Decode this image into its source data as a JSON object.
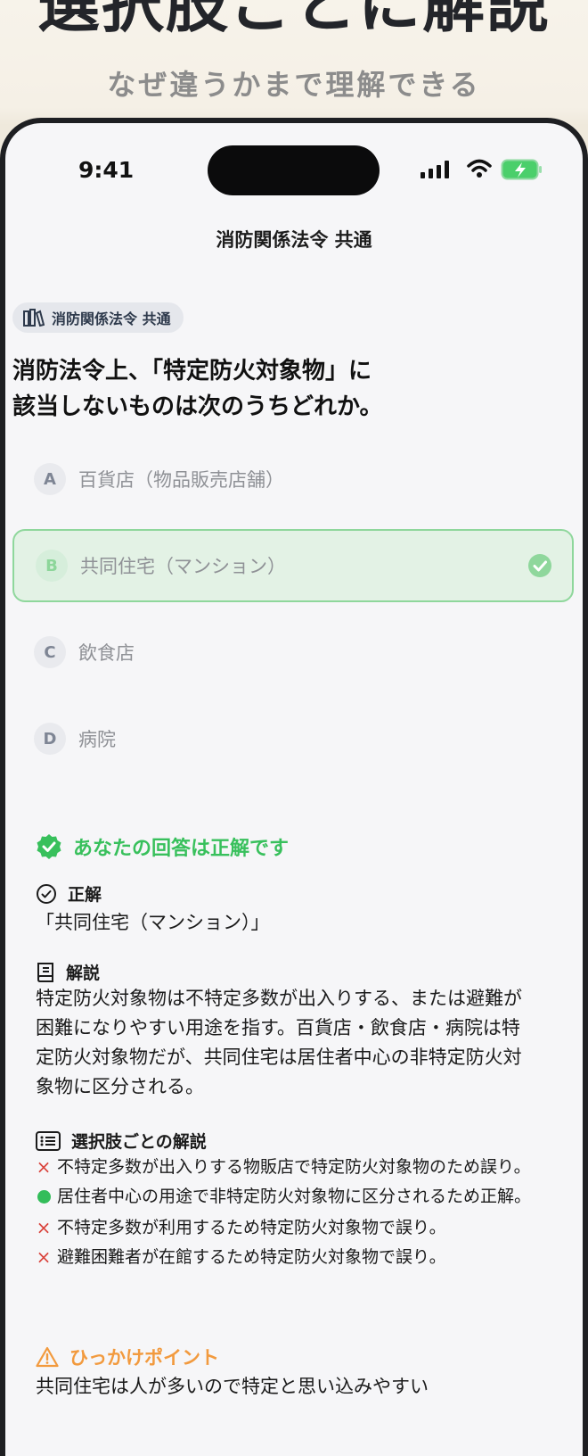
{
  "hero": {
    "title": "選択肢ごとに解説",
    "subtitle": "なぜ違うかまで理解できる"
  },
  "status_bar": {
    "time": "9:41",
    "icons": [
      "signal-icon",
      "wifi-icon",
      "battery-charging-icon"
    ]
  },
  "nav": {
    "title": "消防関係法令 共通"
  },
  "category_tag": {
    "icon": "book-shelf-icon",
    "label": "消防関係法令 共通"
  },
  "question": {
    "line1": "消防法令上、「特定防火対象物」に",
    "line2": "該当しないものは次のうちどれか。"
  },
  "options": [
    {
      "letter": "A",
      "text": "百貨店（物品販売店舗）",
      "state": "default"
    },
    {
      "letter": "B",
      "text": "共同住宅（マンション）",
      "state": "correct"
    },
    {
      "letter": "C",
      "text": "飲食店",
      "state": "default"
    },
    {
      "letter": "D",
      "text": "病院",
      "state": "default"
    }
  ],
  "result": {
    "icon": "check-badge-icon",
    "text": "あなたの回答は正解です"
  },
  "answer": {
    "heading": "正解",
    "value": "「共同住宅（マンション）」"
  },
  "explanation": {
    "heading": "解説",
    "body": "特定防火対象物は不特定多数が出入りする、または避難が困難になりやすい用途を指す。百貨店・飲食店・病院は特定防火対象物だが、共同住宅は居住者中心の非特定防火対象物に区分される。"
  },
  "per_choice": {
    "heading": "選択肢ごとの解説",
    "items": [
      {
        "mark": "×",
        "type": "wrong",
        "text": "不特定多数が出入りする物販店で特定防火対象物のため誤り。"
      },
      {
        "mark": "",
        "type": "right",
        "text": "居住者中心の用途で非特定防火対象物に区分されるため正解。"
      },
      {
        "mark": "×",
        "type": "wrong",
        "text": "不特定多数が利用するため特定防火対象物で誤り。"
      },
      {
        "mark": "×",
        "type": "wrong",
        "text": "避難困難者が在館するため特定防火対象物で誤り。"
      }
    ]
  },
  "trap": {
    "heading": "ひっかけポイント",
    "body": "共同住宅は人が多いので特定と思い込みやすい"
  },
  "colors": {
    "accent_green": "#38c05c",
    "correct_bg": "#e3f2e5",
    "wrong_mark": "#d9423b",
    "warning": "#f29a3e"
  }
}
